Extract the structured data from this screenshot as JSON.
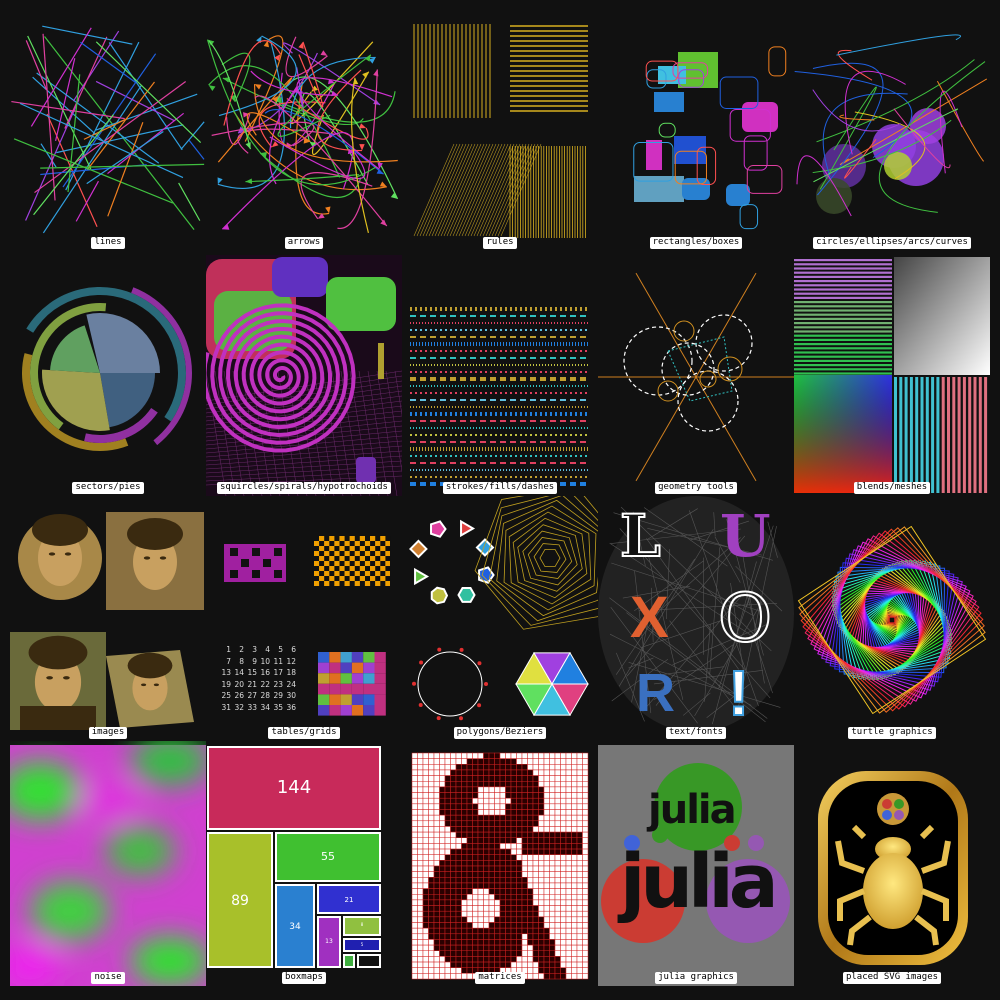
{
  "labels": {
    "lines": "lines",
    "arrows": "arrows",
    "rules": "rules",
    "rectangles": "rectangles/boxes",
    "circles": "circles/ellipses/arcs/curves",
    "sectors": "sectors/pies",
    "squircles": "squircles/spirals/hypotrochoids",
    "strokes": "strokes/fills/dashes",
    "geometry": "geometry tools",
    "blends": "blends/meshes",
    "images": "images",
    "tables": "tables/grids",
    "polygons": "polygons/Beziers",
    "text": "text/fonts",
    "turtle": "turtle graphics",
    "noise": "noise",
    "boxmaps": "boxmaps",
    "matrices": "matrices",
    "julia": "julia graphics",
    "svg": "placed SVG images"
  },
  "table_numbers": [
    [
      "1",
      "2",
      "3",
      "4",
      "5",
      "6"
    ],
    [
      "7",
      "8",
      "9",
      "10",
      "11",
      "12"
    ],
    [
      "13",
      "14",
      "15",
      "16",
      "17",
      "18"
    ],
    [
      "19",
      "20",
      "21",
      "22",
      "23",
      "24"
    ],
    [
      "25",
      "26",
      "27",
      "28",
      "29",
      "30"
    ],
    [
      "31",
      "32",
      "33",
      "34",
      "35",
      "36"
    ]
  ],
  "boxmap_values": {
    "a": "144",
    "b": "89",
    "c": "55",
    "d": "34",
    "e": "21",
    "f": "13",
    "g": "8",
    "h": "5"
  },
  "luxor_letters": {
    "l": "L",
    "u": "U",
    "x": "X",
    "o": "O",
    "r": "R",
    "bang": "!"
  },
  "julia_words": {
    "small": "julia",
    "large": "julia"
  },
  "colors": {
    "background": "#111111",
    "label_bg": "#ffffff",
    "julia_red": "#cb3c33",
    "julia_green": "#389826",
    "julia_purple": "#9558b2",
    "julia_blue": "#4063d8",
    "gold": "#e0b030"
  }
}
